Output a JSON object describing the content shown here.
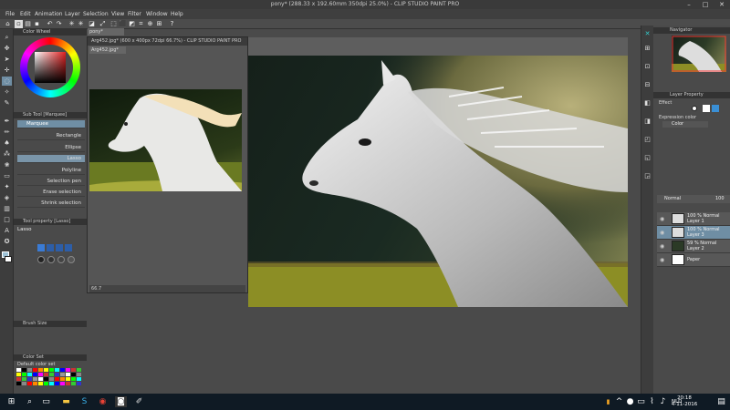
{
  "app": {
    "title": "pony* (288.33 x 192.60mm 350dpi 25.0%)  - CLIP STUDIO PAINT PRO"
  },
  "menu": [
    "File",
    "Edit",
    "Animation",
    "Layer",
    "Selection",
    "View",
    "Filter",
    "Window",
    "Help"
  ],
  "left_panel": {
    "color_wheel_title": "Color Wheel",
    "sub_tool_title": "Sub Tool [Marquee]",
    "sub_tools_tab": "Marquee",
    "sub_tools": [
      "Rectangle",
      "Ellipse",
      "Lasso",
      "Polyline",
      "Selection pen",
      "Erase selection",
      "Shrink selection"
    ],
    "selected_sub_tool": "Lasso",
    "tool_property_title": "Tool property [Lasso]",
    "tool_property_name": "Lasso",
    "brush_size_title": "Brush Size",
    "color_set_title": "Color Set",
    "color_set_name": "Default color set"
  },
  "sub_canvas": {
    "title": "Arg452.jpg* (600 x 400px 72dpi 66.7%)  - CLIP STUDIO PAINT PRO",
    "tab": "Arg452.jpg*",
    "status_zoom": "66.7"
  },
  "main_canvas": {
    "tab": "pony*"
  },
  "right_panel": {
    "navigator_title": "Navigator",
    "layer_property_title": "Layer Property",
    "effect_label": "Effect",
    "expression_color_label": "Expression color",
    "expression_color_value": "Color",
    "blend_mode": "Normal",
    "opacity": "100",
    "layers": [
      {
        "line1": "100 %  Normal",
        "line2": "Layer 1",
        "selected": false
      },
      {
        "line1": "100 %  Normal",
        "line2": "Layer 3",
        "selected": true
      },
      {
        "line1": "59 %  Normal",
        "line2": "Layer 2",
        "selected": false
      },
      {
        "line1": "",
        "line2": "Paper",
        "selected": false
      }
    ]
  },
  "taskbar": {
    "language": "NLD",
    "time": "20:18",
    "date": "4-11-2016"
  }
}
